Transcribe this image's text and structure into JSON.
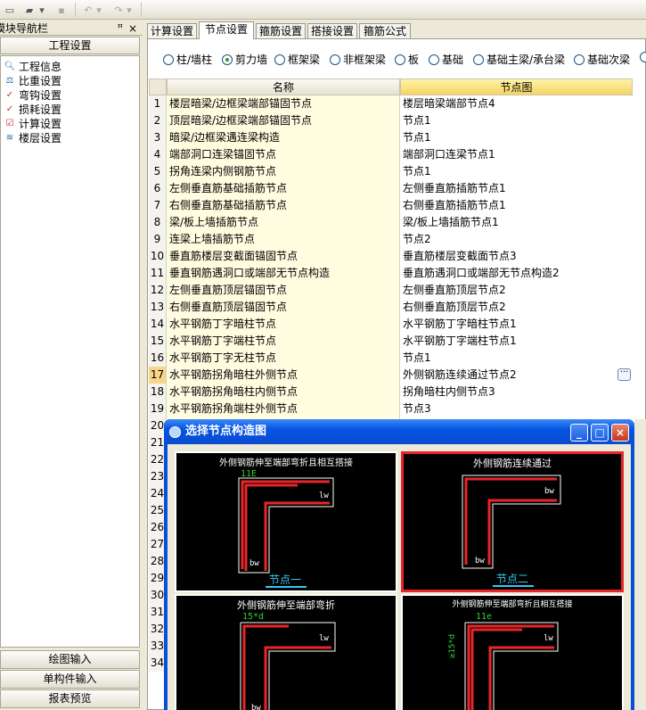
{
  "nav": {
    "header": "模块导航栏",
    "pin": "ꟸ",
    "close": "×",
    "section": "工程设置",
    "items": [
      {
        "label": "工程信息"
      },
      {
        "label": "比重设置"
      },
      {
        "label": "弯钩设置"
      },
      {
        "label": "损耗设置"
      },
      {
        "label": "计算设置"
      },
      {
        "label": "楼层设置"
      }
    ],
    "bottom": [
      "绘图输入",
      "单构件输入",
      "报表预览"
    ]
  },
  "tabs": [
    "计算设置",
    "节点设置",
    "箍筋设置",
    "搭接设置",
    "箍筋公式"
  ],
  "radios": [
    {
      "label": "柱/墙柱",
      "checked": false
    },
    {
      "label": "剪力墙",
      "checked": true
    },
    {
      "label": "框架梁",
      "checked": false
    },
    {
      "label": "非框架梁",
      "checked": false
    },
    {
      "label": "板",
      "checked": false
    },
    {
      "label": "基础",
      "checked": false
    },
    {
      "label": "基础主梁/承台梁",
      "checked": false
    },
    {
      "label": "基础次梁",
      "checked": false
    }
  ],
  "grid": {
    "col_name": "名称",
    "col_node": "节点图",
    "rows": [
      {
        "n": "1",
        "name": "楼层暗梁/边框梁端部锚固节点",
        "node": "楼层暗梁端部节点4"
      },
      {
        "n": "2",
        "name": "顶层暗梁/边框梁端部锚固节点",
        "node": "节点1"
      },
      {
        "n": "3",
        "name": "暗梁/边框梁遇连梁构造",
        "node": "节点1"
      },
      {
        "n": "4",
        "name": "端部洞口连梁锚固节点",
        "node": "端部洞口连梁节点1"
      },
      {
        "n": "5",
        "name": "拐角连梁内侧钢筋节点",
        "node": "节点1"
      },
      {
        "n": "6",
        "name": "左侧垂直筋基础插筋节点",
        "node": "左侧垂直筋插筋节点1"
      },
      {
        "n": "7",
        "name": "右侧垂直筋基础插筋节点",
        "node": "右侧垂直筋插筋节点1"
      },
      {
        "n": "8",
        "name": "梁/板上墙插筋节点",
        "node": "梁/板上墙插筋节点1"
      },
      {
        "n": "9",
        "name": "连梁上墙插筋节点",
        "node": "节点2"
      },
      {
        "n": "10",
        "name": "垂直筋楼层变截面锚固节点",
        "node": "垂直筋楼层变截面节点3"
      },
      {
        "n": "11",
        "name": "垂直钢筋遇洞口或端部无节点构造",
        "node": "垂直筋遇洞口或端部无节点构造2"
      },
      {
        "n": "12",
        "name": "左侧垂直筋顶层锚固节点",
        "node": "左侧垂直筋顶层节点2"
      },
      {
        "n": "13",
        "name": "右侧垂直筋顶层锚固节点",
        "node": "右侧垂直筋顶层节点2"
      },
      {
        "n": "14",
        "name": "水平钢筋丁字暗柱节点",
        "node": "水平钢筋丁字暗柱节点1"
      },
      {
        "n": "15",
        "name": "水平钢筋丁字端柱节点",
        "node": "水平钢筋丁字端柱节点1"
      },
      {
        "n": "16",
        "name": "水平钢筋丁字无柱节点",
        "node": "节点1"
      },
      {
        "n": "17",
        "name": "水平钢筋拐角暗柱外侧节点",
        "node": "外侧钢筋连续通过节点2"
      },
      {
        "n": "18",
        "name": "水平钢筋拐角暗柱内侧节点",
        "node": "拐角暗柱内侧节点3"
      },
      {
        "n": "19",
        "name": "水平钢筋拐角端柱外侧节点",
        "node": "节点3"
      },
      {
        "n": "20",
        "name": "",
        "node": ""
      },
      {
        "n": "21",
        "name": "",
        "node": ""
      },
      {
        "n": "22",
        "name": "",
        "node": ""
      },
      {
        "n": "23",
        "name": "",
        "node": ""
      },
      {
        "n": "24",
        "name": "",
        "node": ""
      },
      {
        "n": "25",
        "name": "",
        "node": ""
      },
      {
        "n": "26",
        "name": "",
        "node": ""
      },
      {
        "n": "27",
        "name": "",
        "node": ""
      },
      {
        "n": "28",
        "name": "",
        "node": ""
      },
      {
        "n": "29",
        "name": "",
        "node": ""
      },
      {
        "n": "30",
        "name": "",
        "node": ""
      },
      {
        "n": "31",
        "name": "",
        "node": ""
      },
      {
        "n": "32",
        "name": "",
        "node": ""
      },
      {
        "n": "33",
        "name": "",
        "node": ""
      },
      {
        "n": "34",
        "name": "",
        "node": ""
      }
    ],
    "dots": "···"
  },
  "dialog": {
    "title": "选择节点构造图",
    "minimize": "_",
    "maximize": "□",
    "close": "×",
    "cells": [
      {
        "title": "外侧钢筋伸至端部弯折且相互搭接",
        "dim_top": "11E",
        "dim_side": "lw",
        "dim_bottom": "bw",
        "caption": "节点一"
      },
      {
        "title": "外侧钢筋连续通过",
        "dim_top": "",
        "dim_side": "bw",
        "dim_bottom": "bw",
        "caption": "节点二"
      },
      {
        "title": "外侧钢筋伸至端部弯折",
        "dim_top": "15*d",
        "dim_side": "lw",
        "dim_bottom": "bw",
        "caption": ""
      },
      {
        "title": "外侧钢筋伸至端部弯折且相互搭接",
        "dim_top": "11e",
        "dim_side": "lw",
        "dim_bottom": "",
        "dim_left": "≥15*d",
        "caption": ""
      }
    ]
  },
  "colors": {
    "accent": "#0a4fd8",
    "selected": "#e8262a",
    "rebar": "#e8262a",
    "dim": "#2dd52d",
    "caption": "#35c8f0"
  }
}
